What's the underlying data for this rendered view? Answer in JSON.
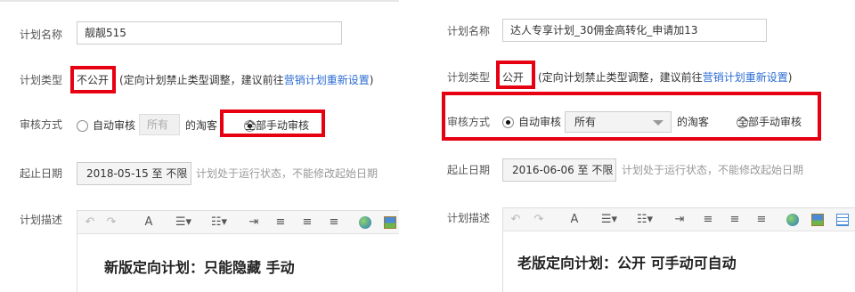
{
  "left_panel": {
    "plan_name_label": "计划名称",
    "plan_name_value": "靓靓515",
    "plan_type_label": "计划类型",
    "plan_type_value": "不公开",
    "plan_type_note": "(定向计划禁止类型调整，建议前往",
    "plan_type_link": "营销计划重新设置",
    "plan_type_note_end": ")",
    "review_label": "审核方式",
    "auto_review": "自动审核",
    "auto_review_select": "所有",
    "customer_suffix": "的淘客",
    "manual_review": "全部手动审核",
    "date_label": "起止日期",
    "date_value": "2018-05-15 至 不限",
    "date_note": "计划处于运行状态，不能修改起始日期",
    "desc_label": "计划描述",
    "editor_text": "新版定向计划：只能隐藏 手动"
  },
  "right_panel": {
    "plan_name_label": "计划名称",
    "plan_name_value": "达人专享计划_30佣金高转化_申请加13",
    "plan_type_label": "计划类型",
    "plan_type_value": "公开",
    "plan_type_note": "(定向计划禁止类型调整，建议前往",
    "plan_type_link": "营销计划重新设置",
    "plan_type_note_end": ")",
    "review_label": "审核方式",
    "auto_review": "自动审核",
    "auto_review_select": "所有",
    "customer_suffix": "的淘客",
    "manual_review": "全部手动审核",
    "date_label": "起止日期",
    "date_value": "2016-06-06 至 不限",
    "date_note": "计划处于运行状态，不能修改起始日期",
    "desc_label": "计划描述",
    "editor_text": "老版定向计划：公开 可手动可自动"
  },
  "toolbar_icons": [
    "undo-icon",
    "redo-icon",
    "format-brush-icon",
    "unordered-list-icon",
    "ordered-list-icon",
    "indent-icon",
    "align-left-icon",
    "align-center-icon",
    "align-right-icon",
    "link-icon",
    "image-icon",
    "table-icon"
  ],
  "colors": {
    "highlight": "#e60012",
    "link": "#2a6bd1"
  }
}
